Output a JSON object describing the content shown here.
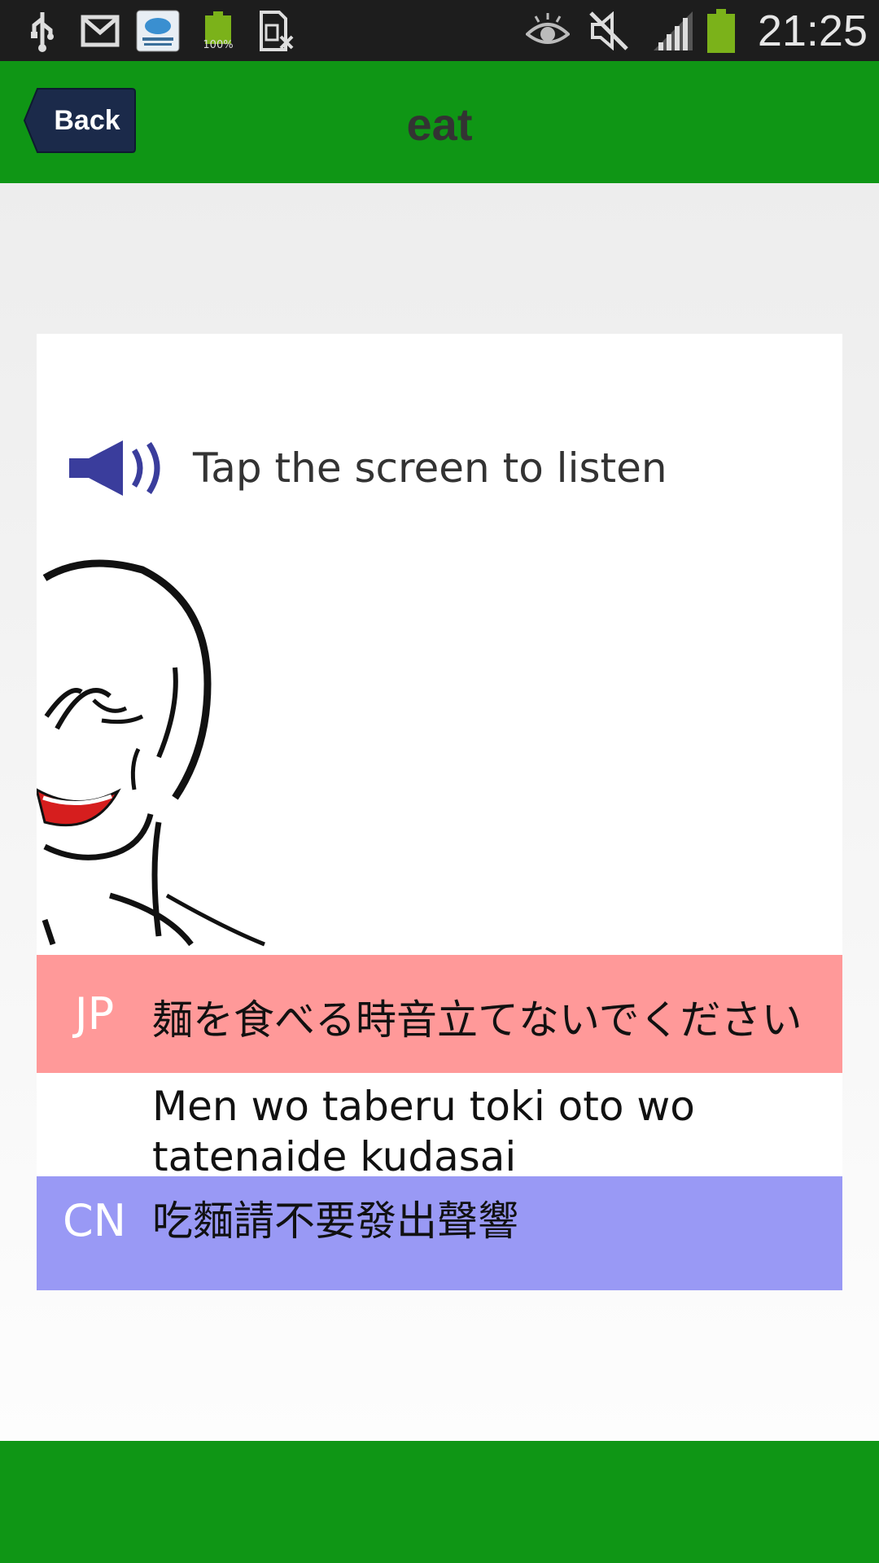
{
  "status_bar": {
    "time": "21:25",
    "battery_badge": "100%",
    "icons": [
      "usb-icon",
      "gmail-icon",
      "cloud-testing-icon",
      "battery-100-icon",
      "sim-error-icon",
      "eye-icon",
      "mute-icon",
      "signal-icon",
      "battery-icon"
    ]
  },
  "header": {
    "back_label": "Back",
    "title": "eat"
  },
  "card": {
    "listen_hint": "Tap the screen to listen",
    "jp_tag": "JP",
    "jp_text": "麺を食べる時音立てないでください",
    "romaji": "Men wo taberu toki oto wo tatenaide kudasai",
    "cn_tag": "CN",
    "cn_text": "吃麵請不要發出聲響"
  },
  "colors": {
    "header_green": "#0f9615",
    "jp_band": "#ff9999",
    "cn_band": "#9999f5",
    "back_button": "#1b2a4a"
  }
}
